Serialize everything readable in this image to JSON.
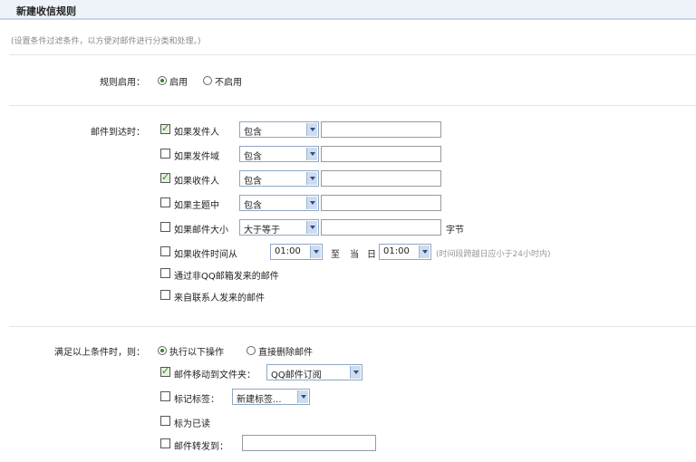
{
  "header": {
    "title": "新建收信规则"
  },
  "description": "(设置条件过滤条件，以方便对邮件进行分类和处理。)",
  "enable": {
    "label": "规则启用：",
    "options": [
      {
        "label": "启用",
        "selected": true
      },
      {
        "label": "不启用",
        "selected": false
      }
    ]
  },
  "conditions": {
    "label": "邮件到达时：",
    "rows": [
      {
        "label": "如果发件人",
        "checked": true,
        "op": "包含"
      },
      {
        "label": "如果发件域",
        "checked": false,
        "op": "包含"
      },
      {
        "label": "如果收件人",
        "checked": true,
        "op": "包含"
      },
      {
        "label": "如果主题中",
        "checked": false,
        "op": "包含"
      },
      {
        "label": "如果邮件大小",
        "checked": false,
        "op": "大于等于",
        "unit": "字节"
      },
      {
        "label": "如果收件时间从",
        "checked": false,
        "from": "01:00",
        "to_word1": "至",
        "to_word2": "当",
        "to_word3": "日",
        "to": "01:00",
        "hint": "(时间段跨越日应小于24小时内)"
      },
      {
        "label": "通过非QQ邮箱发来的邮件",
        "checked": false
      },
      {
        "label": "来自联系人发来的邮件",
        "checked": false
      }
    ]
  },
  "actions": {
    "label": "满足以上条件时，则：",
    "options": [
      {
        "label": "执行以下操作",
        "selected": true
      },
      {
        "label": "直接删除邮件",
        "selected": false
      }
    ],
    "rows": [
      {
        "label": "邮件移动到文件夹：",
        "checked": true,
        "select": "QQ邮件订阅"
      },
      {
        "label": "标记标签：",
        "checked": false,
        "select": "新建标签..."
      },
      {
        "label": "标为已读",
        "checked": false
      },
      {
        "label": "邮件转发到：",
        "checked": false
      }
    ]
  }
}
